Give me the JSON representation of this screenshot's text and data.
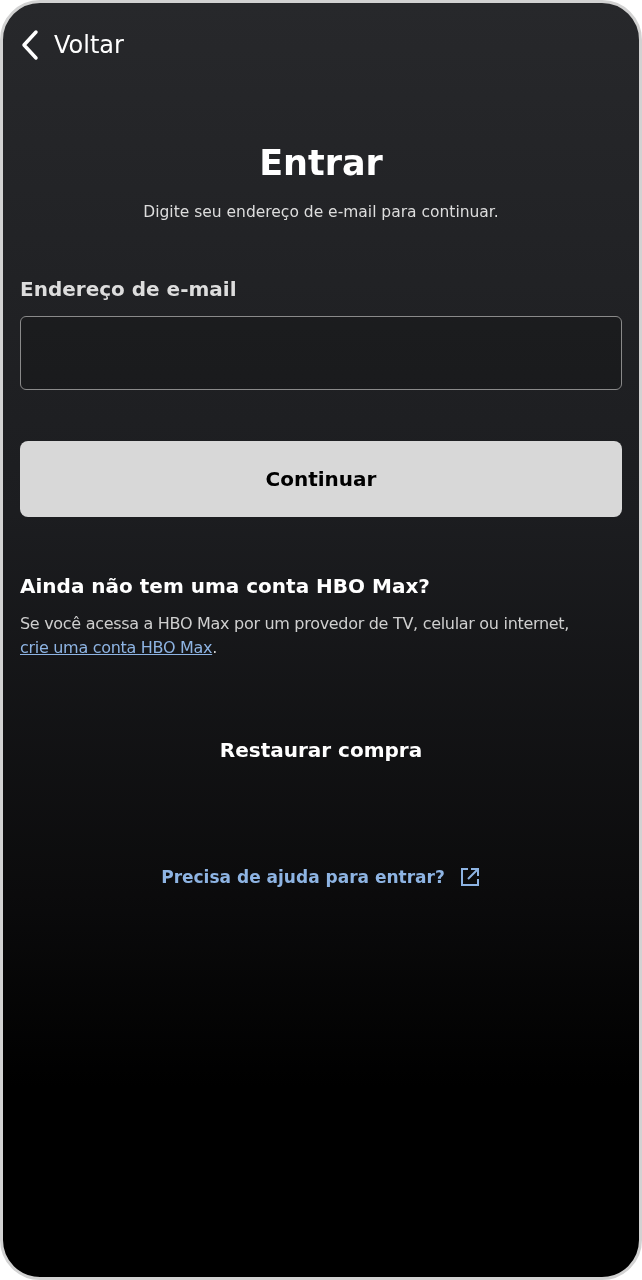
{
  "back": {
    "label": "Voltar"
  },
  "title": "Entrar",
  "subtitle": "Digite seu endereço de e-mail para continuar.",
  "email_field": {
    "label": "Endereço de e-mail"
  },
  "continue_button": {
    "label": "Continuar"
  },
  "signup": {
    "heading": "Ainda não tem uma conta HBO Max?",
    "text_before": "Se você acessa a HBO Max por um provedor de TV, celular ou internet,",
    "link": "crie uma conta HBO Max",
    "text_after": "."
  },
  "restore_button": {
    "label": "Restaurar compra"
  },
  "help_link": {
    "label": "Precisa de ajuda para entrar?"
  }
}
